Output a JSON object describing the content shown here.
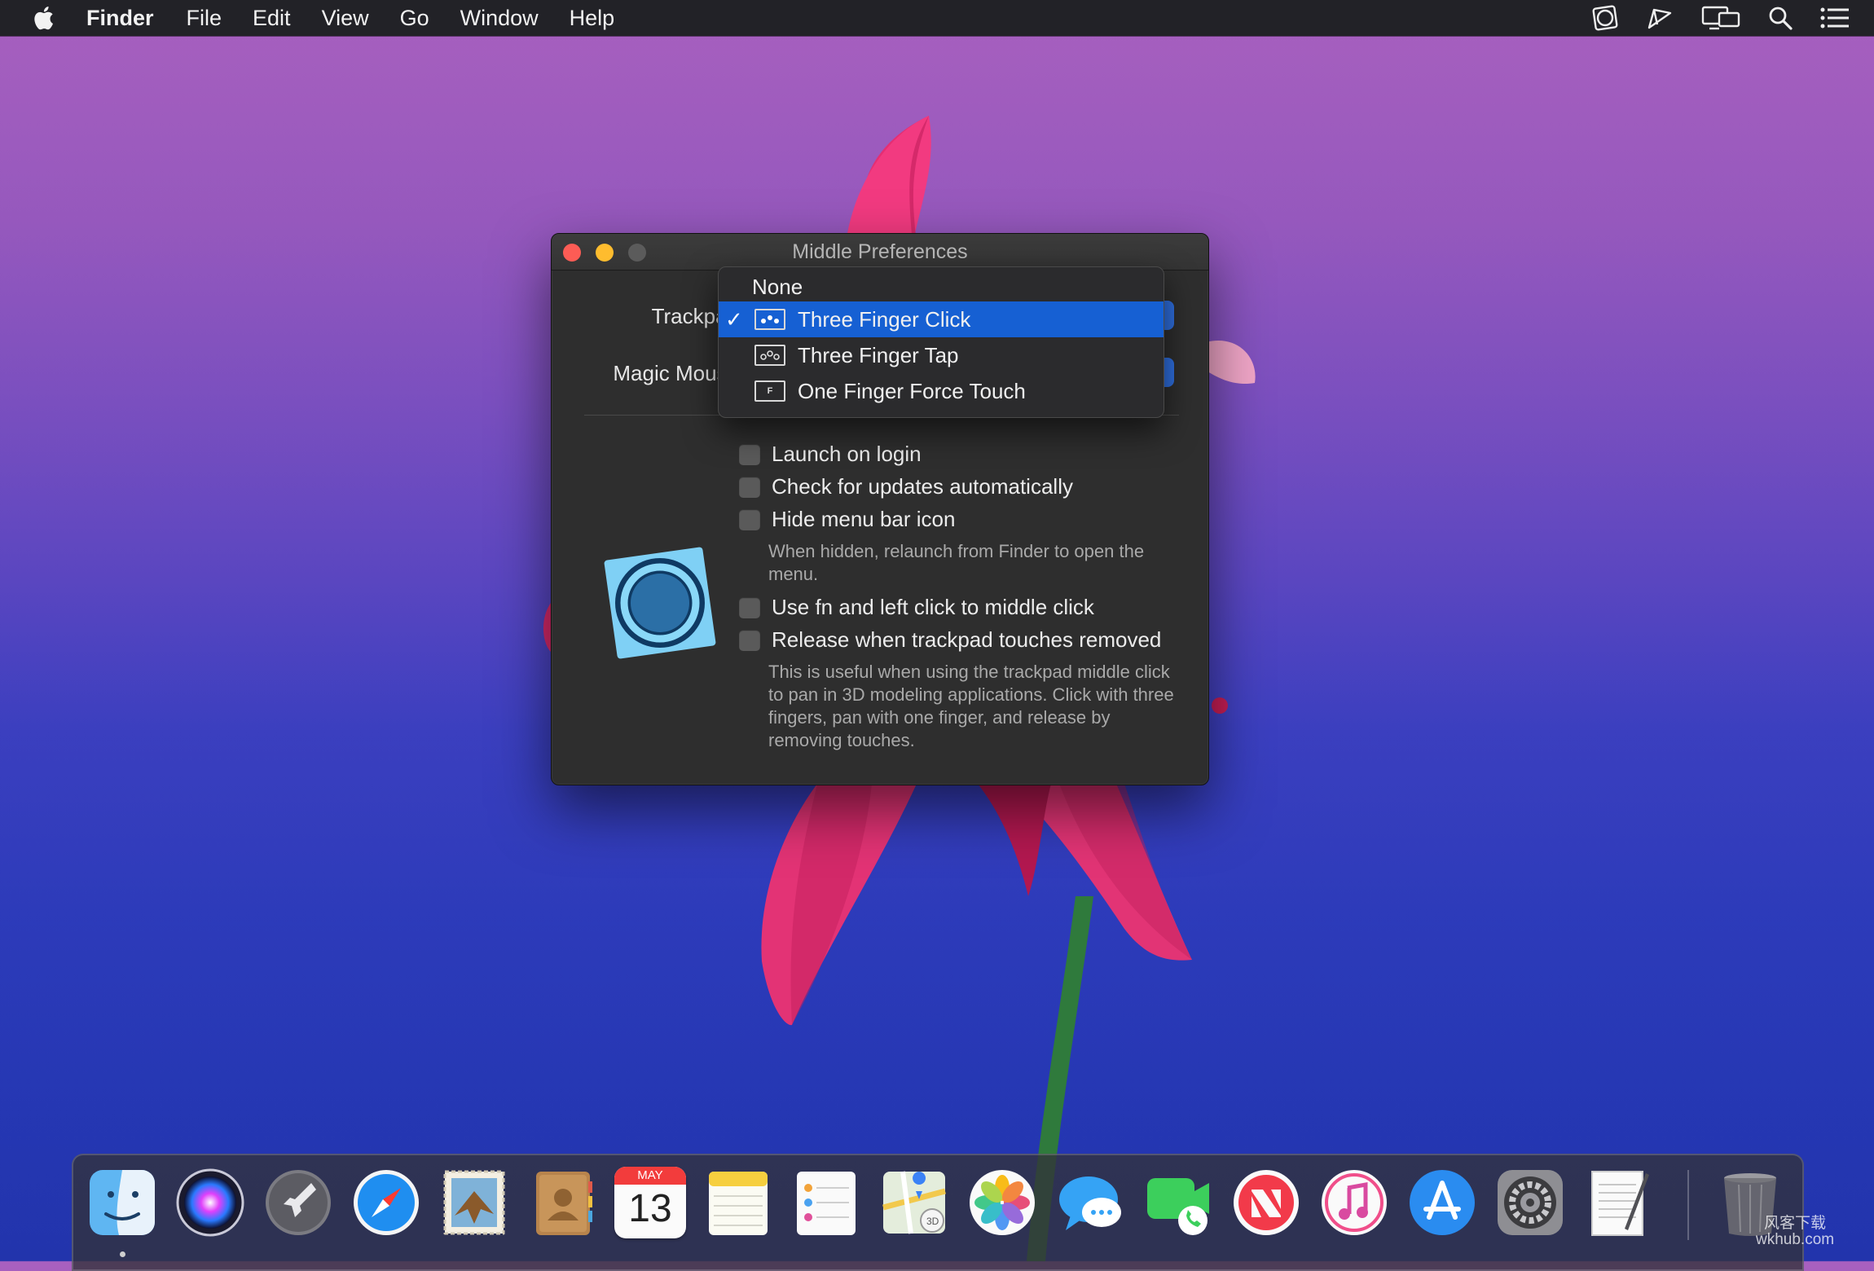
{
  "menubar": {
    "app_name": "Finder",
    "items": [
      "File",
      "Edit",
      "View",
      "Go",
      "Window",
      "Help"
    ],
    "status_icons": [
      "middle-app-icon",
      "cast-icon",
      "display-mirroring-icon",
      "spotlight-search-icon",
      "notification-center-icon"
    ]
  },
  "window": {
    "title": "Middle Preferences",
    "trackpad_label": "Trackpad",
    "magic_mouse_label": "Magic Mouse",
    "checkboxes": [
      {
        "label": "Launch on login",
        "checked": false
      },
      {
        "label": "Check for updates automatically",
        "checked": false
      },
      {
        "label": "Hide menu bar icon",
        "checked": false
      },
      {
        "label": "Use fn and left click to middle click",
        "checked": false
      },
      {
        "label": "Release when trackpad touches removed",
        "checked": false
      }
    ],
    "hide_icon_help": "When hidden, relaunch from Finder to open the menu.",
    "release_help": "This is useful when using the trackpad middle click to pan in 3D modeling applications. Click with three fingers, pan with one finger, and release by removing touches."
  },
  "dropdown": {
    "items": [
      {
        "label": "None",
        "icon": "",
        "selected": false
      },
      {
        "label": "Three Finger Click",
        "icon": "three-finger-click-icon",
        "selected": true
      },
      {
        "label": "Three Finger Tap",
        "icon": "three-finger-tap-icon",
        "selected": false
      },
      {
        "label": "One Finger Force Touch",
        "icon": "force-touch-icon",
        "selected": false
      }
    ],
    "selected_mark": "✓",
    "force_touch_glyph": "F"
  },
  "dock": {
    "apps": [
      "Finder",
      "Siri",
      "Launchpad",
      "Safari",
      "Mail",
      "Contacts",
      "Calendar",
      "Notes",
      "Reminders",
      "Maps",
      "Photos",
      "Messages",
      "FaceTime",
      "News",
      "iTunes",
      "App Store",
      "System Preferences",
      "TextEdit",
      "Trash"
    ],
    "calendar_month": "MAY",
    "calendar_day": "13"
  },
  "watermark": {
    "line1": "风客下载",
    "line2": "wkhub.com"
  },
  "colors": {
    "accent": "#1660d3",
    "window_bg": "#2e2e2e",
    "menubar_bg": "#222227"
  }
}
